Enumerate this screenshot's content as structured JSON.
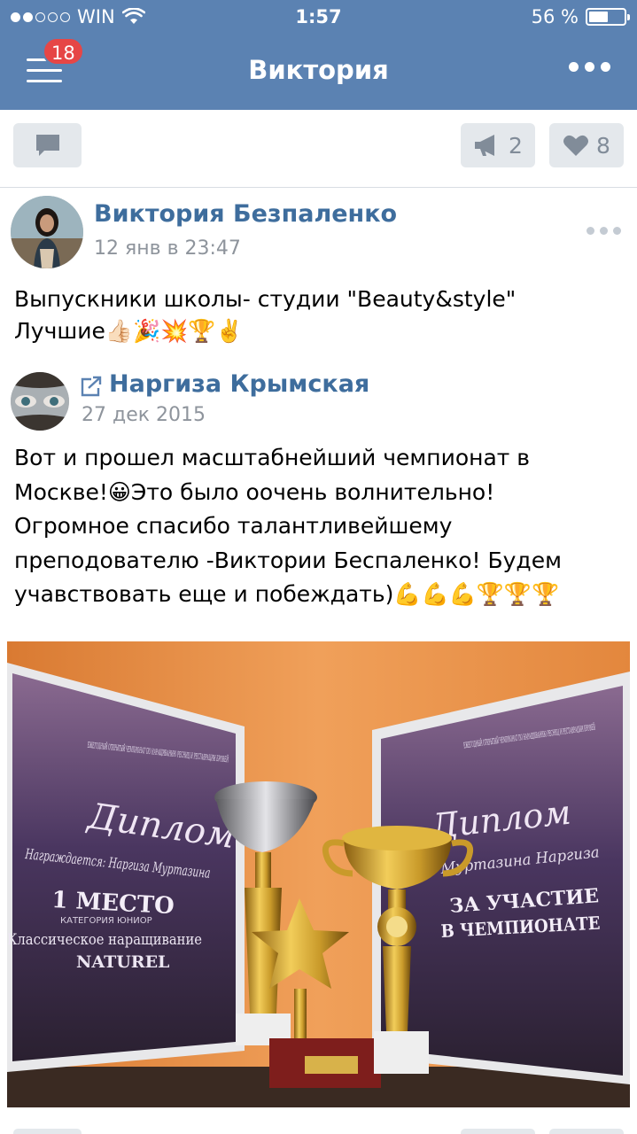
{
  "status_bar": {
    "carrier": "WIN",
    "time": "1:57",
    "battery": "56 %",
    "battery_level": 0.56,
    "signal_bars_filled": 2,
    "signal_bars_total": 5
  },
  "header": {
    "title": "Виктория",
    "notification_count": "18",
    "menu_icon": "hamburger-icon",
    "more_icon": "more-dots-icon"
  },
  "actions": {
    "comment_icon": "comment-icon",
    "repost_count": "2",
    "repost_icon": "megaphone-icon",
    "like_count": "8",
    "like_icon": "heart-icon"
  },
  "post": {
    "author": "Виктория Безпаленко",
    "time": "12 янв в 23:47",
    "text_lines": [
      "Выпускники школы- студии \"Beauty&style\"",
      "Лучшие👍🏻🎉💥🏆✌️"
    ]
  },
  "repost": {
    "author": "Наргиза Крымская",
    "time": "27 дек 2015",
    "text_lines": [
      "Вот и прошел масштабнейший чемпионат в",
      "Москве!😀Это было  оочень волнительно!",
      "Огромное спасибо талантливейшему",
      "преподователю -Виктории Беспаленко! Будем",
      "учавствовать еще и побеждать)💪💪💪🏆🏆🏆"
    ]
  },
  "photo": {
    "left_diploma": {
      "header": "ЕЖЕГОДНЫЙ ОТКРЫТЫЙ ЧЕМПИОНАТ ПО НАРАЩИВАНИЮ РЕСНИЦ И РЕСТАВРАЦИИ БРОВЕЙ",
      "script": "Диплом",
      "awarded": "Награждается: Наргиза Муртазина",
      "place": "1 МЕСТО",
      "category": "КАТЕГОРИЯ ЮНИОР",
      "discipline": "Классическое наращивание",
      "technique": "NATUREL"
    },
    "right_diploma": {
      "header": "ЕЖЕГОДНЫЙ ОТКРЫТЫЙ ЧЕМПИОНАТ ПО НАРАЩИВАНИЮ РЕСНИЦ И РЕСТАВРАЦИИ БРОВЕЙ",
      "script": "Диплом",
      "awarded": "Муртазина Наргиза",
      "line1": "ЗА УЧАСТИЕ",
      "line2": "В ЧЕМПИОНАТЕ"
    }
  },
  "colors": {
    "header_bg": "#5b82b2",
    "link": "#3e6d9d",
    "badge": "#e64646",
    "muted": "#8e949c",
    "button_bg": "#e4e8ec"
  }
}
